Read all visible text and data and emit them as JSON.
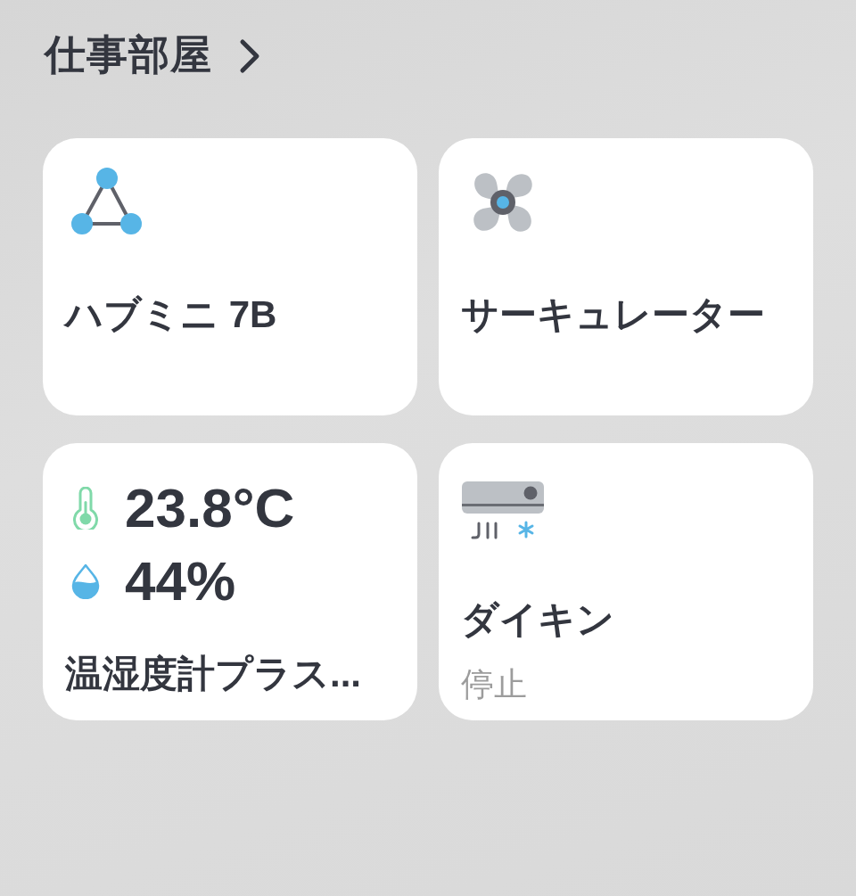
{
  "room": {
    "title": "仕事部屋"
  },
  "devices": [
    {
      "kind": "hub",
      "name": "ハブミニ 7B"
    },
    {
      "kind": "fan",
      "name": "サーキュレーター"
    },
    {
      "kind": "meter",
      "readings": [
        {
          "kind": "temperature",
          "value": "23.8°C"
        },
        {
          "kind": "humidity",
          "value": "44%"
        }
      ],
      "name": "温湿度計プラス..."
    },
    {
      "kind": "aircon",
      "name": "ダイキン",
      "status": "停止"
    }
  ]
}
